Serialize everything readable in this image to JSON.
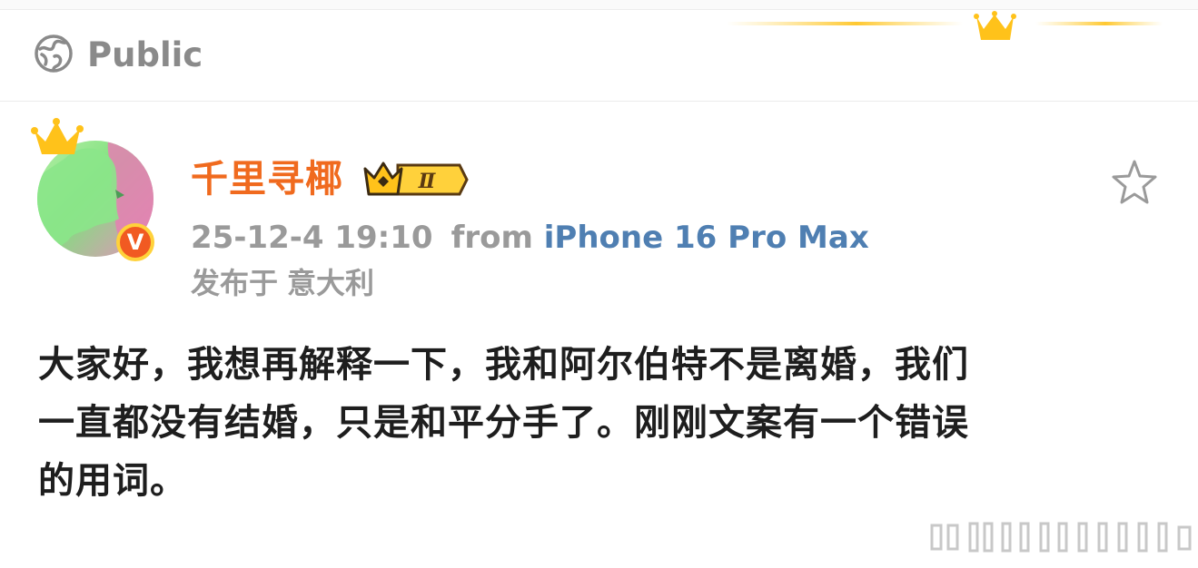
{
  "header": {
    "visibility_label": "Public",
    "icon": "globe-icon"
  },
  "user": {
    "name": "千里寻椰",
    "vip_level": "Ⅱ",
    "verified_mark": "V",
    "avatar_icon": "avatar-with-crown"
  },
  "meta": {
    "time": "25-12-4 19:10",
    "from_label": "from",
    "device": "iPhone 16 Pro Max",
    "location_prefix": "发布于",
    "location": "意大利"
  },
  "post": {
    "lines": [
      "大家好，我想再解释一下，我和阿尔伯特不是离婚，我们",
      "一直都没有结婚，只是和平分手了。刚刚文案有一个错误",
      "的用词。"
    ]
  },
  "actions": {
    "favorite_icon": "star-outline-icon"
  },
  "colors": {
    "username": "#f06a1e",
    "device_link": "#4f7fb2",
    "muted_text": "#9a9a9a",
    "body_text": "#1e1e1e",
    "verified_badge": "#f15a22",
    "crown_gold": "#ffc21a"
  }
}
